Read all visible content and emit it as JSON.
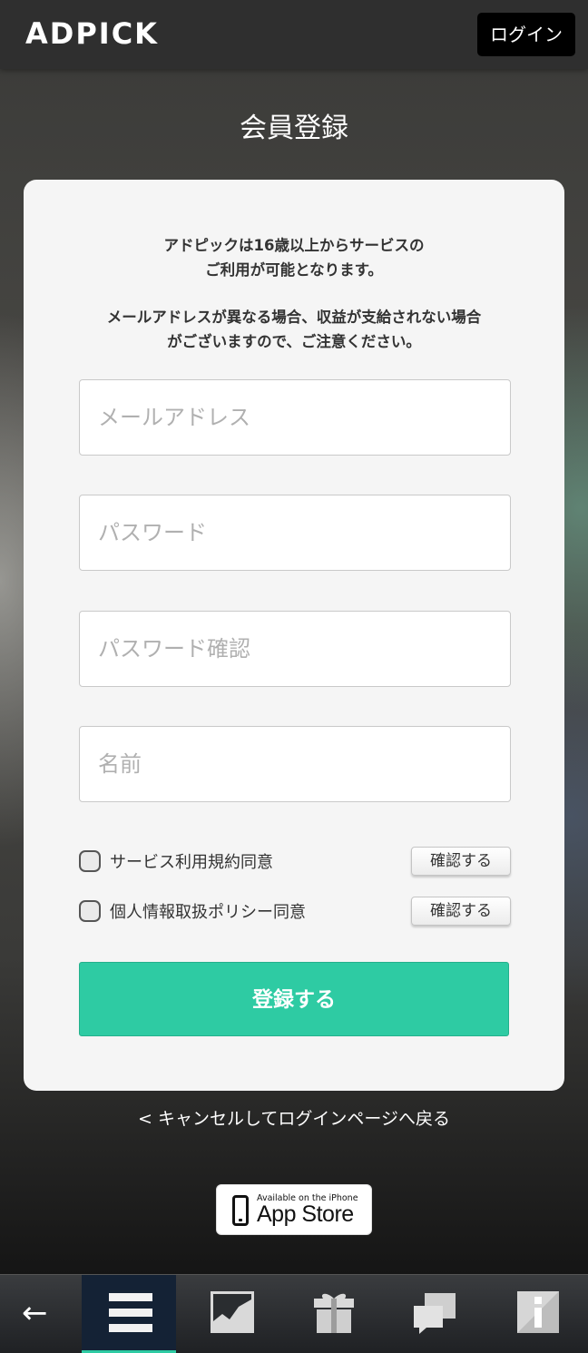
{
  "header": {
    "logo": "ADPICK",
    "login_label": "ログイン"
  },
  "page": {
    "title": "会員登録",
    "notice_line1": "アドピックは16歳以上からサービスの",
    "notice_line2": "ご利用が可能となります。",
    "notice_line3": "メールアドレスが異なる場合、収益が支給されない場合",
    "notice_line4": "がございますので、ご注意ください。"
  },
  "form": {
    "email_placeholder": "メールアドレス",
    "password_placeholder": "パスワード",
    "password_confirm_placeholder": "パスワード確認",
    "name_placeholder": "名前",
    "agreements": [
      {
        "label": "サービス利用規約同意",
        "checked": false,
        "confirm_label": "確認する"
      },
      {
        "label": "個人情報取扱ポリシー同意",
        "checked": false,
        "confirm_label": "確認する"
      }
    ],
    "submit_label": "登録する",
    "submit_color": "#2ecba3"
  },
  "footer": {
    "cancel_link": "< キャンセルしてログインページへ戻る",
    "appstore_small": "Available on the iPhone",
    "appstore_big": "App Store"
  },
  "tabbar": {
    "items": [
      {
        "icon": "back-arrow-icon",
        "glyph": "←"
      },
      {
        "icon": "menu-icon",
        "active": true
      },
      {
        "icon": "chart-icon"
      },
      {
        "icon": "gift-icon"
      },
      {
        "icon": "chat-icon"
      },
      {
        "icon": "info-icon"
      }
    ]
  }
}
